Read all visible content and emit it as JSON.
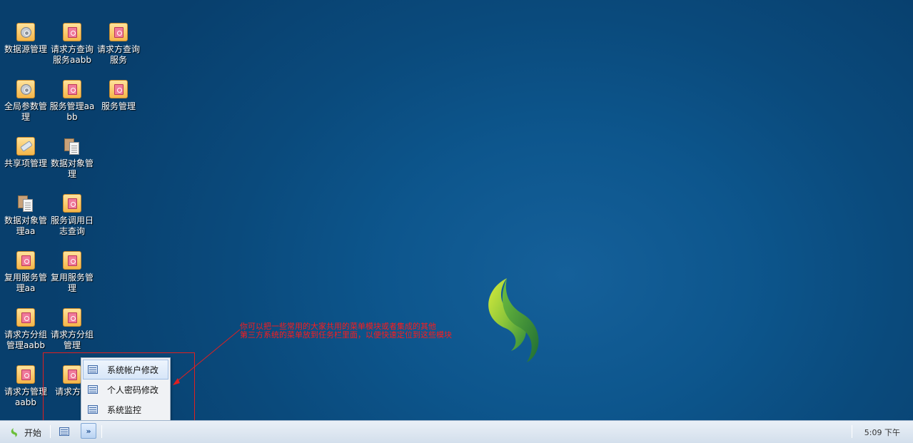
{
  "desktop": {
    "icons": [
      {
        "label": "数据源管理",
        "icon": "gear-icon"
      },
      {
        "label": "请求方查询服务aabb",
        "icon": "form-icon"
      },
      {
        "label": "请求方查询服务",
        "icon": "form-icon"
      },
      {
        "label": "全局参数管理",
        "icon": "gear-icon"
      },
      {
        "label": "服务管理aabb",
        "icon": "form-icon"
      },
      {
        "label": "服务管理",
        "icon": "form-icon"
      },
      {
        "label": "共享项管理",
        "icon": "pencil-icon"
      },
      {
        "label": "数据对象管理",
        "icon": "documents-icon"
      },
      {
        "label": "数据对象管理aa",
        "icon": "documents-icon"
      },
      {
        "label": "服务调用日志查询",
        "icon": "form-icon"
      },
      {
        "label": "复用服务管理aa",
        "icon": "form-icon"
      },
      {
        "label": "复用服务管理",
        "icon": "form-icon"
      },
      {
        "label": "请求方分组管理aabb",
        "icon": "form-icon"
      },
      {
        "label": "请求方分组管理",
        "icon": "form-icon"
      },
      {
        "label": "请求方管理aabb",
        "icon": "form-icon"
      },
      {
        "label": "请求方管",
        "icon": "form-icon"
      }
    ]
  },
  "annotation": {
    "line1": "你可以把一些常用的大家共用的菜单模块或者集成的其他",
    "line2": "第三方系统的菜单放到任务栏里面，以便快速定位到这些模块",
    "color": "#ff1b1b"
  },
  "popup_menu": {
    "items": [
      {
        "label": "系统帐户修改",
        "icon": "list-icon"
      },
      {
        "label": "个人密码修改",
        "icon": "list-icon"
      },
      {
        "label": "系统监控",
        "icon": "list-icon"
      }
    ]
  },
  "taskbar": {
    "start_label": "开始",
    "more_label": "»",
    "clock": "5:09 下午"
  },
  "colors": {
    "desktop_bg": "#0a4a7c",
    "taskbar_bg": "#d3dfec",
    "logo_green": "#5fb83a"
  }
}
